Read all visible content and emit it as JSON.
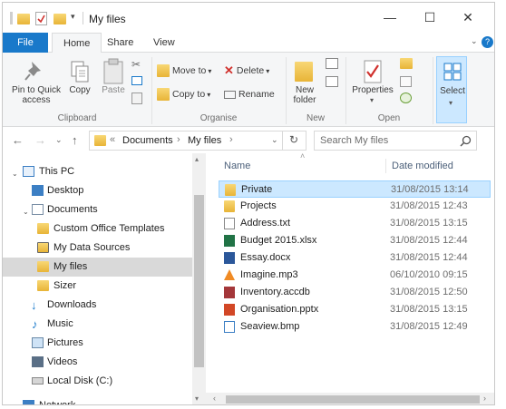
{
  "window": {
    "title": "My files"
  },
  "window_controls": {
    "minimize": "—",
    "maximize": "☐",
    "close": "✕"
  },
  "tabs": [
    {
      "label": "File"
    },
    {
      "label": "Home"
    },
    {
      "label": "Share"
    },
    {
      "label": "View"
    }
  ],
  "ribbon": {
    "clipboard": {
      "label": "Clipboard",
      "pin": "Pin to Quick access",
      "copy": "Copy",
      "paste": "Paste"
    },
    "organise": {
      "label": "Organise",
      "move_to": "Move to",
      "copy_to": "Copy to",
      "delete": "Delete",
      "rename": "Rename"
    },
    "new": {
      "label": "New",
      "new_folder": "New folder"
    },
    "open": {
      "label": "Open",
      "properties": "Properties"
    },
    "select": {
      "label": "Select"
    }
  },
  "address": {
    "breadcrumb": [
      "Documents",
      "My files"
    ],
    "search_placeholder": "Search My files"
  },
  "nav": [
    {
      "label": "This PC",
      "icon": "computer-icon"
    },
    {
      "label": "Desktop",
      "icon": "desktop-icon"
    },
    {
      "label": "Documents",
      "icon": "documents-icon"
    },
    {
      "label": "Custom Office Templates",
      "icon": "folder-icon"
    },
    {
      "label": "My Data Sources",
      "icon": "data-sources-icon"
    },
    {
      "label": "My files",
      "icon": "folder-icon",
      "selected": true
    },
    {
      "label": "Sizer",
      "icon": "folder-icon"
    },
    {
      "label": "Downloads",
      "icon": "downloads-icon"
    },
    {
      "label": "Music",
      "icon": "music-icon"
    },
    {
      "label": "Pictures",
      "icon": "pictures-icon"
    },
    {
      "label": "Videos",
      "icon": "videos-icon"
    },
    {
      "label": "Local Disk (C:)",
      "icon": "disk-icon"
    },
    {
      "label": "Network",
      "icon": "network-icon"
    }
  ],
  "columns": {
    "name": "Name",
    "date": "Date modified"
  },
  "files": [
    {
      "name": "Private",
      "date": "31/08/2015 13:14",
      "icon": "folder-icon",
      "selected": true
    },
    {
      "name": "Projects",
      "date": "31/08/2015 12:43",
      "icon": "folder-icon"
    },
    {
      "name": "Address.txt",
      "date": "31/08/2015 13:15",
      "icon": "text-file-icon"
    },
    {
      "name": "Budget 2015.xlsx",
      "date": "31/08/2015 12:44",
      "icon": "excel-icon"
    },
    {
      "name": "Essay.docx",
      "date": "31/08/2015 12:44",
      "icon": "word-icon"
    },
    {
      "name": "Imagine.mp3",
      "date": "06/10/2010 09:15",
      "icon": "audio-icon"
    },
    {
      "name": "Inventory.accdb",
      "date": "31/08/2015 12:50",
      "icon": "access-icon"
    },
    {
      "name": "Organisation.pptx",
      "date": "31/08/2015 13:15",
      "icon": "powerpoint-icon"
    },
    {
      "name": "Seaview.bmp",
      "date": "31/08/2015 12:49",
      "icon": "image-icon"
    }
  ]
}
